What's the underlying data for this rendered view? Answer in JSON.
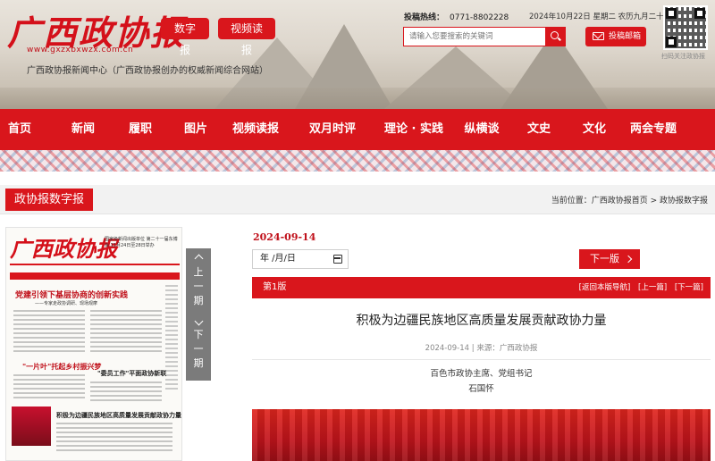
{
  "header": {
    "logo_text": "广西政协报",
    "site_url": "www.gxzxbxwzx.com.cn",
    "slogan": "广西政协报新闻中心（广西政协报创办的权威新闻综合网站）",
    "buttons": [
      "数字报",
      "视频读报"
    ],
    "hotline_label": "投稿热线：",
    "hotline_number": "0771-8802228",
    "date_text": "2024年10月22日 星期二 农历九月二十",
    "search_placeholder": "请输入您要搜索的关键词",
    "mail_label": "投稿邮箱",
    "qr_caption": "扫码关注政协报"
  },
  "nav": {
    "items": [
      "首页",
      "新闻",
      "履职",
      "图片",
      "视频读报",
      "双月时评",
      "理论 · 实践",
      "纵横谈",
      "文史",
      "文化",
      "两会专题"
    ]
  },
  "section": {
    "title": "政协报数字报",
    "breadcrumb": "当前位置：广西政协报首页 > 政协报数字报"
  },
  "paper": {
    "masthead": "广西政协报",
    "top_note": "国家级新闻出版单位 第二十一届东博会 11月24日至28日举办",
    "headline_1": "党建引领下基层协商的创新实践",
    "subhead_1": "——专家走政协调研、现场观摩",
    "headline_2": "\"一片叶\"托起乡村振兴梦",
    "headline_3": "\"委员工作\"平面政协新联",
    "headline_4": "积极为边疆民族地区高质量发展贡献政协力量"
  },
  "period": {
    "prev_label": [
      "上",
      "一",
      "期"
    ],
    "next_label": [
      "下",
      "一",
      "期"
    ]
  },
  "edition": {
    "date": "2024-09-14",
    "date_input_value": "年 /月/日",
    "next_button": "下一版",
    "name": "第1版",
    "links": [
      "[返回本版导航]",
      "[上一篇]",
      "[下一篇]"
    ]
  },
  "article": {
    "title": "积极为边疆民族地区高质量发展贡献政协力量",
    "meta": "2024-09-14 | 来源：广西政协报",
    "author_line1": "百色市政协主席、党组书记",
    "author_line2": "石国怀"
  },
  "colors": {
    "brand_red": "#d9161c",
    "period_gray": "#7b7b7b"
  }
}
